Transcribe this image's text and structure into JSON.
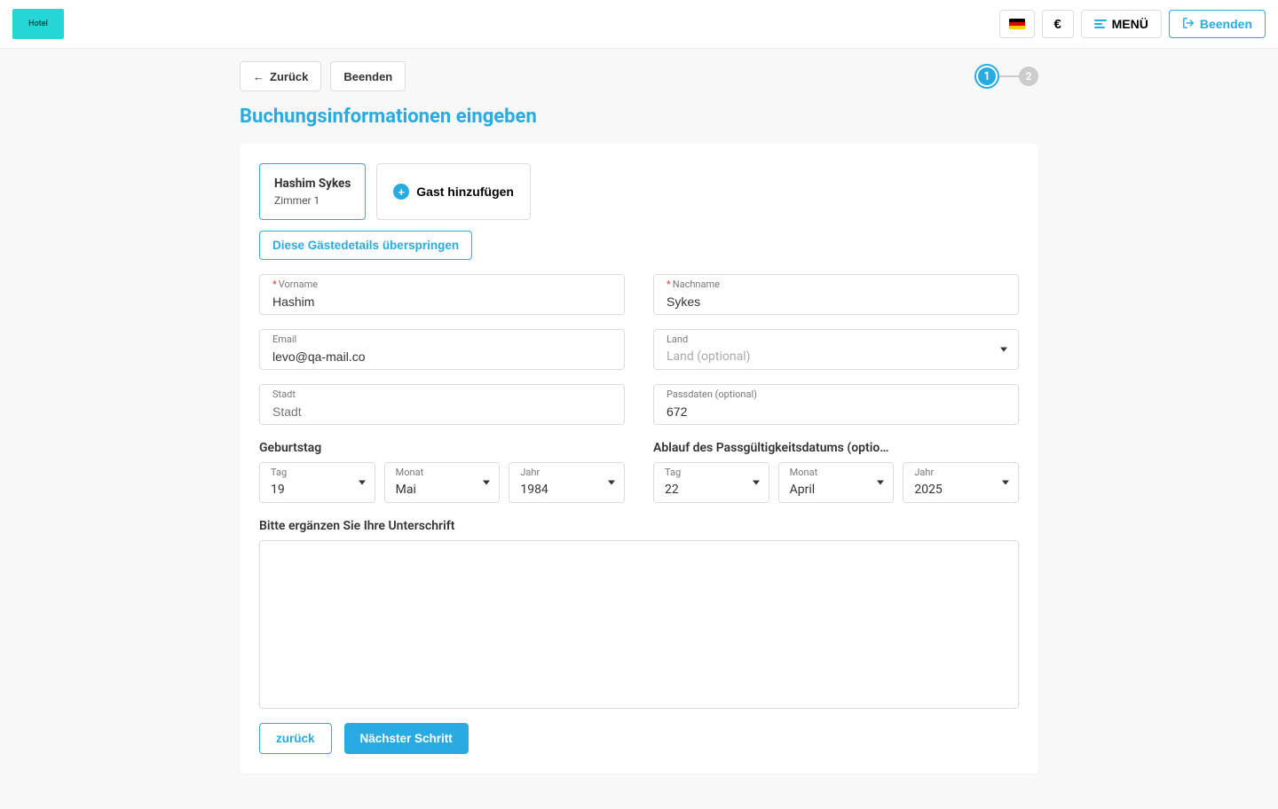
{
  "topbar": {
    "logo_text": "Hotel",
    "currency_symbol": "€",
    "menu_label": "MENÜ",
    "exit_label": "Beenden"
  },
  "actions": {
    "back_label": "Zurück",
    "finish_label": "Beenden"
  },
  "stepper": {
    "steps": [
      "1",
      "2"
    ],
    "active": 0
  },
  "page_title": "Buchungsinformationen eingeben",
  "guest_tab": {
    "name": "Hashim Sykes",
    "room": "Zimmer 1"
  },
  "add_guest_label": "Gast hinzufügen",
  "skip_label": "Diese Gästedetails überspringen",
  "fields": {
    "firstname": {
      "label": "Vorname",
      "value": "Hashim",
      "required": true
    },
    "lastname": {
      "label": "Nachname",
      "value": "Sykes",
      "required": true
    },
    "email": {
      "label": "Email",
      "value": "levo@qa-mail.co",
      "required": false
    },
    "country": {
      "label": "Land",
      "placeholder": "Land (optional)"
    },
    "city": {
      "label": "Stadt",
      "placeholder": "Stadt"
    },
    "passport": {
      "label": "Passdaten (optional)",
      "value": "672"
    }
  },
  "birthday": {
    "title": "Geburtstag",
    "day": {
      "label": "Tag",
      "value": "19"
    },
    "month": {
      "label": "Monat",
      "value": "Mai"
    },
    "year": {
      "label": "Jahr",
      "value": "1984"
    }
  },
  "passport_expiry": {
    "title": "Ablauf des Passgültigkeitsdatums (optio…",
    "day": {
      "label": "Tag",
      "value": "22"
    },
    "month": {
      "label": "Monat",
      "value": "April"
    },
    "year": {
      "label": "Jahr",
      "value": "2025"
    }
  },
  "signature_label": "Bitte ergänzen Sie Ihre Unterschrift",
  "footer": {
    "back": "zurück",
    "next": "Nächster Schritt"
  }
}
